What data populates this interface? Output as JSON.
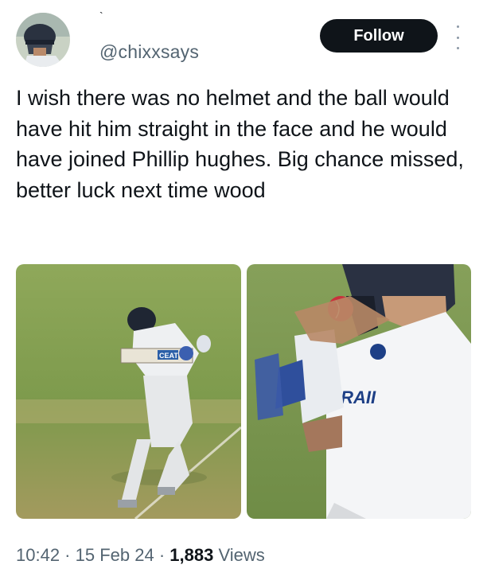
{
  "user": {
    "name_mark": "`",
    "handle": "@chixxsays"
  },
  "follow_button": {
    "label": "Follow"
  },
  "more_menu": {
    "icon": "more-vertical-icon"
  },
  "tweet": {
    "text": "I wish there was no helmet and the ball would have hit him straight in the face and he would have joined Phillip hughes. Big chance missed, better luck next time wood"
  },
  "media": {
    "left_bat_logo": "CEAT",
    "right_jersey_text": "IRAII"
  },
  "meta": {
    "time": "10:42",
    "sep1": " · ",
    "date": "15 Feb 24",
    "sep2": " · ",
    "views_count": "1,883",
    "views_label": " Views"
  },
  "colors": {
    "text": "#0f1419",
    "secondary": "#536471",
    "button": "#0f1419",
    "pitch_green": "#7f9b4c"
  }
}
